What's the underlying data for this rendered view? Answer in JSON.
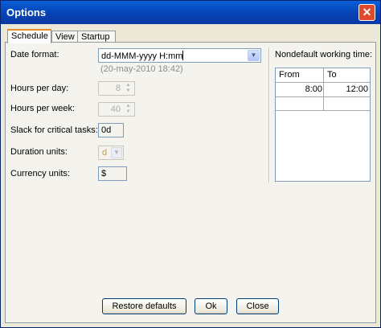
{
  "window": {
    "title": "Options",
    "close_glyph": "✕"
  },
  "tabs": [
    "Schedule",
    "View",
    "Startup"
  ],
  "schedule": {
    "date_format_label": "Date format:",
    "date_format_value": "dd-MMM-yyyy H:mm",
    "date_format_example": "(20-may-2010 18:42)",
    "hours_per_day_label": "Hours per day:",
    "hours_per_day_value": "8",
    "hours_per_week_label": "Hours per week:",
    "hours_per_week_value": "40",
    "slack_label": "Slack for critical tasks:",
    "slack_value": "0d",
    "duration_units_label": "Duration units:",
    "duration_units_value": "d",
    "currency_units_label": "Currency units:",
    "currency_units_value": "$"
  },
  "working_time": {
    "label": "Nondefault working time:",
    "columns": [
      "From",
      "To"
    ],
    "rows": [
      [
        "8:00",
        "12:00"
      ],
      [
        "",
        ""
      ]
    ]
  },
  "buttons": {
    "restore": "Restore defaults",
    "ok": "Ok",
    "close": "Close"
  },
  "icons": {
    "close": "close-icon",
    "dropdown": "chevron-down-icon",
    "spinner": "spinner-arrows-icon"
  },
  "colors": {
    "titlebar": "#0a5fd8",
    "close_button": "#e04a2c",
    "active_tab_accent": "#e68b2c"
  }
}
